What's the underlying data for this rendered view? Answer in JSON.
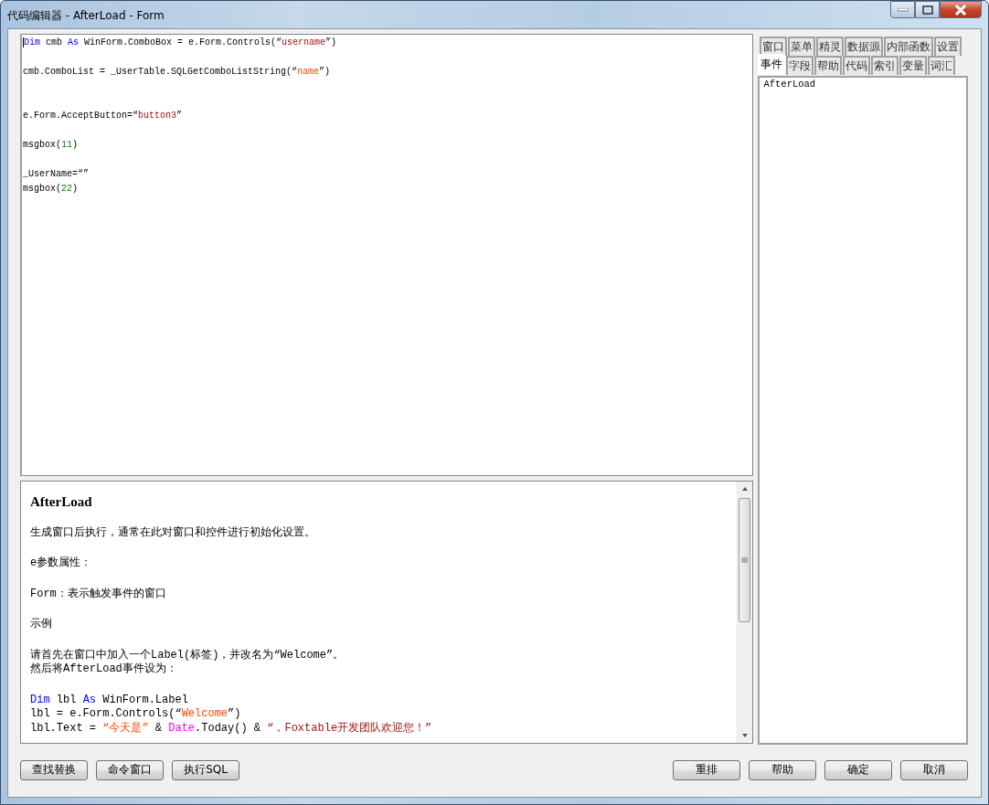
{
  "window": {
    "title": "代码编辑器 - AfterLoad - Form"
  },
  "editor": {
    "lines": [
      {
        "kind": "code",
        "segments": [
          {
            "kind": "keyword",
            "text": "Dim"
          },
          {
            "kind": "plain",
            "text": " cmb "
          },
          {
            "kind": "keyword",
            "text": "As"
          },
          {
            "kind": "plain",
            "text": " WinForm.ComboBox = e.Form.Controls(“"
          },
          {
            "kind": "string",
            "text": "username"
          },
          {
            "kind": "plain",
            "text": "”)"
          }
        ]
      },
      {
        "kind": "blank"
      },
      {
        "kind": "code",
        "segments": [
          {
            "kind": "plain",
            "text": "cmb.ComboList = _UserTable.SQLGetComboListString(“"
          },
          {
            "kind": "string2",
            "text": "name"
          },
          {
            "kind": "plain",
            "text": "”)"
          }
        ]
      },
      {
        "kind": "blank"
      },
      {
        "kind": "blank"
      },
      {
        "kind": "code",
        "segments": [
          {
            "kind": "plain",
            "text": "e.Form.AcceptButton=“"
          },
          {
            "kind": "string",
            "text": "button3"
          },
          {
            "kind": "plain",
            "text": "”"
          }
        ]
      },
      {
        "kind": "blank"
      },
      {
        "kind": "code",
        "segments": [
          {
            "kind": "plain",
            "text": "msgbox("
          },
          {
            "kind": "number",
            "text": "11"
          },
          {
            "kind": "plain",
            "text": ")"
          }
        ]
      },
      {
        "kind": "blank"
      },
      {
        "kind": "code",
        "segments": [
          {
            "kind": "plain",
            "text": "_UserName=“”"
          }
        ]
      },
      {
        "kind": "code",
        "segments": [
          {
            "kind": "plain",
            "text": "msgbox("
          },
          {
            "kind": "number",
            "text": "22"
          },
          {
            "kind": "plain",
            "text": ")"
          }
        ]
      }
    ]
  },
  "help": {
    "lines": [
      {
        "kind": "heading",
        "segments": [
          {
            "kind": "plain",
            "text": "AfterLoad"
          }
        ]
      },
      {
        "kind": "blank"
      },
      {
        "kind": "text",
        "segments": [
          {
            "kind": "plain",
            "text": "生成窗口后执行，通常在此对窗口和控件进行初始化设置。"
          }
        ]
      },
      {
        "kind": "blank"
      },
      {
        "kind": "text",
        "segments": [
          {
            "kind": "plain",
            "text": "e参数属性："
          }
        ]
      },
      {
        "kind": "blank"
      },
      {
        "kind": "text",
        "segments": [
          {
            "kind": "plain",
            "text": "Form：表示触发事件的窗口"
          }
        ]
      },
      {
        "kind": "blank"
      },
      {
        "kind": "text",
        "segments": [
          {
            "kind": "plain",
            "text": "示例"
          }
        ]
      },
      {
        "kind": "blank"
      },
      {
        "kind": "text",
        "segments": [
          {
            "kind": "plain",
            "text": "请首先在窗口中加入一个Label(标签)，并改名为“Welcome”。"
          }
        ]
      },
      {
        "kind": "text",
        "segments": [
          {
            "kind": "plain",
            "text": "然后将AfterLoad事件设为："
          }
        ]
      },
      {
        "kind": "blank"
      },
      {
        "kind": "code",
        "segments": [
          {
            "kind": "keyword",
            "text": "Dim"
          },
          {
            "kind": "plain",
            "text": " lbl "
          },
          {
            "kind": "keyword",
            "text": "As"
          },
          {
            "kind": "plain",
            "text": " WinForm.Label"
          }
        ]
      },
      {
        "kind": "code",
        "segments": [
          {
            "kind": "plain",
            "text": "lbl = e.Form.Controls(“"
          },
          {
            "kind": "string2",
            "text": "Welcome"
          },
          {
            "kind": "plain",
            "text": "”)"
          }
        ]
      },
      {
        "kind": "code",
        "segments": [
          {
            "kind": "plain",
            "text": "lbl.Text = "
          },
          {
            "kind": "string2",
            "text": "“今天是”"
          },
          {
            "kind": "plain",
            "text": " & "
          },
          {
            "kind": "builtin",
            "text": "Date"
          },
          {
            "kind": "plain",
            "text": ".Today() & "
          },
          {
            "kind": "string",
            "text": "“，Foxtable开发团队欢迎您！”"
          }
        ]
      }
    ]
  },
  "side_tabs_upper": [
    {
      "label": "窗口",
      "selected": false
    },
    {
      "label": "菜单",
      "selected": false
    },
    {
      "label": "精灵",
      "selected": false
    },
    {
      "label": "数据源",
      "selected": false
    },
    {
      "label": "内部函数",
      "selected": false
    },
    {
      "label": "设置",
      "selected": false
    }
  ],
  "side_tabs_lower": [
    {
      "label": "事件",
      "selected": true
    },
    {
      "label": "字段",
      "selected": false
    },
    {
      "label": "帮助",
      "selected": false
    },
    {
      "label": "代码",
      "selected": false
    },
    {
      "label": "索引",
      "selected": false
    },
    {
      "label": "变量",
      "selected": false
    },
    {
      "label": "词汇",
      "selected": false
    }
  ],
  "event_list": {
    "items": [
      "AfterLoad"
    ]
  },
  "buttons_left": [
    "查找替换",
    "命令窗口",
    "执行SQL"
  ],
  "buttons_right": [
    "重排",
    "帮助",
    "确定",
    "取消"
  ]
}
